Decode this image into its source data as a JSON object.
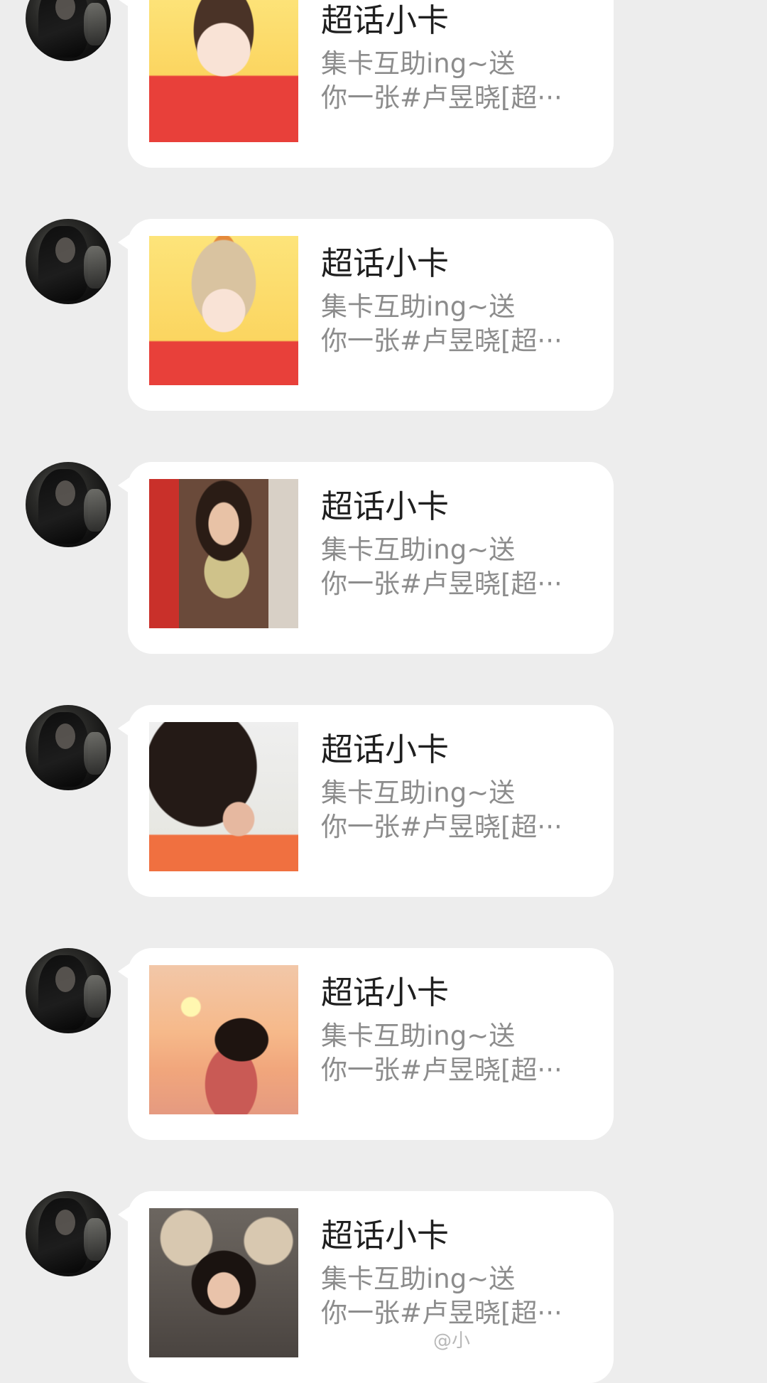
{
  "messages": [
    {
      "title": "超话小卡",
      "desc_line1": "集卡互助ing~送",
      "desc_line2": "你一张#卢昱晓[超···",
      "thumb": "cartoon-boy"
    },
    {
      "title": "超话小卡",
      "desc_line1": "集卡互助ing~送",
      "desc_line2": "你一张#卢昱晓[超···",
      "thumb": "cartoon-girl"
    },
    {
      "title": "超话小卡",
      "desc_line1": "集卡互助ing~送",
      "desc_line2": "你一张#卢昱晓[超···",
      "thumb": "photo-durian"
    },
    {
      "title": "超话小卡",
      "desc_line1": "集卡互助ing~送",
      "desc_line2": "你一张#卢昱晓[超···",
      "thumb": "photo-hair"
    },
    {
      "title": "超话小卡",
      "desc_line1": "集卡互助ing~送",
      "desc_line2": "你一张#卢昱晓[超···",
      "thumb": "photo-sunset"
    },
    {
      "title": "超话小卡",
      "desc_line1": "集卡互助ing~送",
      "desc_line2": "你一张#卢昱晓[超···",
      "thumb": "photo-crown"
    }
  ],
  "watermark": "@小"
}
